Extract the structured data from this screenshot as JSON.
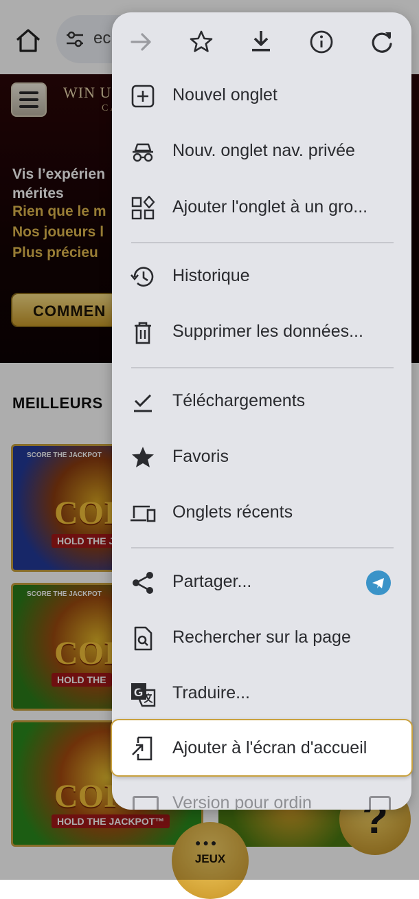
{
  "browser": {
    "omnibox_text": "ec"
  },
  "site": {
    "logo_text": "WIN U",
    "logo_sub": "CA",
    "hero_line1": "Vis l’expérien",
    "hero_line2": "mérites",
    "hero_gold": [
      "Rien que le m",
      "Nos joueurs l",
      "Plus précieu"
    ],
    "cta_label": "COMMEN",
    "section_title": "MEILLEURS",
    "tiles": [
      {
        "word": "COI",
        "ribbon": "HOLD THE J",
        "badge": "SCORE THE JACKPOT"
      },
      {
        "word": "COI",
        "ribbon": "HOLD THE",
        "badge": "SCORE THE JACKPOT"
      },
      {
        "word": "COI",
        "ribbon": "HOLD THE JACKPOT™",
        "badge": ""
      }
    ],
    "jeux_label": "JEUX",
    "help_label": "?"
  },
  "menu": {
    "top_actions": [
      "forward-icon",
      "bookmark-star-icon",
      "download-icon",
      "info-icon",
      "reload-icon"
    ],
    "items": [
      {
        "label": "Nouvel onglet",
        "icon": "new-tab-icon"
      },
      {
        "label": "Nouv. onglet nav. privée",
        "icon": "incognito-icon"
      },
      {
        "label": "Ajouter l'onglet à un gro...",
        "icon": "tab-group-icon"
      },
      {
        "label": "Historique",
        "icon": "history-icon"
      },
      {
        "label": "Supprimer les données...",
        "icon": "trash-icon"
      },
      {
        "label": "Téléchargements",
        "icon": "downloads-check-icon"
      },
      {
        "label": "Favoris",
        "icon": "star-icon"
      },
      {
        "label": "Onglets récents",
        "icon": "devices-icon"
      },
      {
        "label": "Partager...",
        "icon": "share-icon"
      },
      {
        "label": "Rechercher sur la page",
        "icon": "find-in-page-icon"
      },
      {
        "label": "Traduire...",
        "icon": "translate-icon"
      },
      {
        "label": "Ajouter à l'écran d'accueil",
        "icon": "add-to-home-icon"
      },
      {
        "label": "Version pour ordin",
        "icon": "desktop-icon"
      }
    ]
  },
  "colors": {
    "menu_bg": "#e3e4e9",
    "highlight_border": "#c9a13e",
    "telegram": "#3a93c8",
    "site_gold": "#e1b94f"
  }
}
